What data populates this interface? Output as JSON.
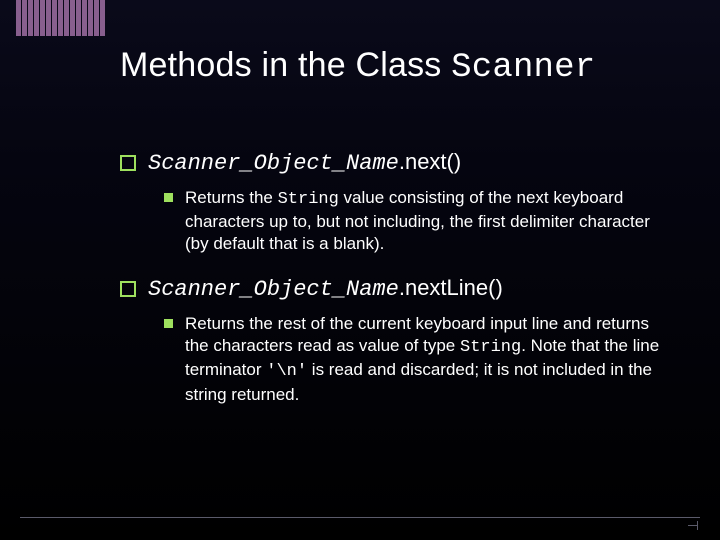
{
  "title": {
    "prefix": "Methods in the Class ",
    "mono": "Scanner"
  },
  "items": [
    {
      "head_mono": "Scanner_Object_Name",
      "head_tail": ".next()",
      "sub_before": "Returns the ",
      "sub_mono1": "String",
      "sub_after": " value consisting of the next keyboard characters up to, but not including, the first delimiter character (by default that is a blank)."
    },
    {
      "head_mono": "Scanner_Object_Name",
      "head_tail": ".nextLine()",
      "sub_before": "Returns the rest of the current keyboard input line and returns the characters read as value of type ",
      "sub_mono1": "String",
      "sub_mid": ".  Note that the line terminator ",
      "sub_mono2": "'\\n'",
      "sub_after": " is read and discarded; it is not included in the string returned."
    }
  ]
}
